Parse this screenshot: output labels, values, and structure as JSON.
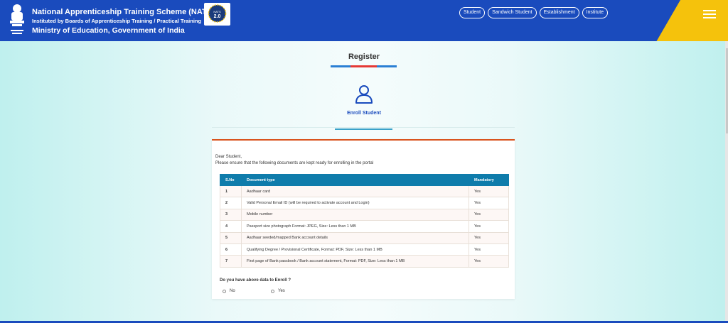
{
  "header": {
    "title": "National Apprenticeship Training Scheme (NATS)",
    "subtitle": "Instituted by Boards of Apprenticeship Training / Practical Training",
    "ministry": "Ministry of Education, Government of India",
    "logo_text": "NATS 2.0",
    "nav": [
      "Student",
      "Sandwich Student",
      "Establishment",
      "Institute"
    ]
  },
  "register": {
    "title": "Register",
    "enroll_label": "Enroll Student"
  },
  "card": {
    "greeting": "Dear Student,",
    "instruction": "Please ensure that the following documents are kept ready for enrolling in the portal",
    "table": {
      "headers": [
        "S.No",
        "Document type",
        "Mandatory"
      ],
      "rows": [
        [
          "1",
          "Aadhaar card",
          "Yes"
        ],
        [
          "2",
          "Valid Personal Email ID (will be required to activate account and Login)",
          "Yes"
        ],
        [
          "3",
          "Mobile number",
          "Yes"
        ],
        [
          "4",
          "Passport size photograph Format: JPEG, Size: Less than 1 MB",
          "Yes"
        ],
        [
          "5",
          "Aadhaar seeded/mapped Bank account details",
          "Yes"
        ],
        [
          "6",
          "Qualifying Degree / Provisional Certificate, Format: PDF, Size: Less than 1 MB",
          "Yes"
        ],
        [
          "7",
          "First page of Bank passbook / Bank account statement, Format: PDF, Size: Less than 1 MB",
          "Yes"
        ]
      ]
    },
    "question": "Do you have above data to Enroll ?",
    "options": [
      "No",
      "Yes"
    ]
  },
  "colors": {
    "header_bg": "#1a4bbd",
    "accent_yellow": "#f5c20c",
    "table_header": "#0f7cab",
    "card_top_border": "#d9541e"
  }
}
